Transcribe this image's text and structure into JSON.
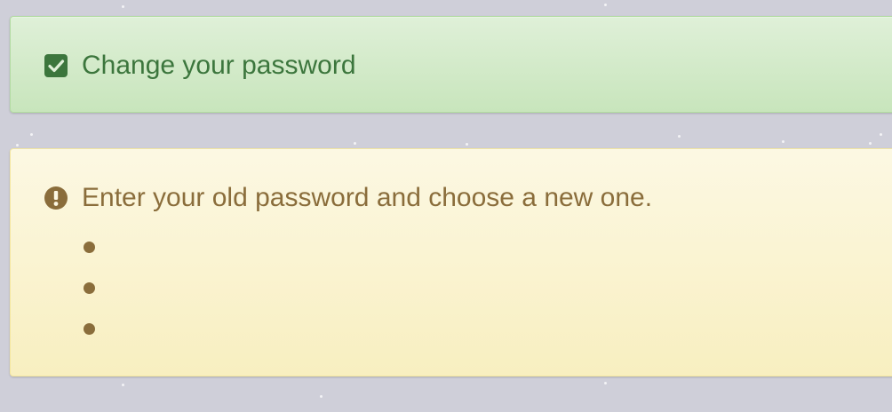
{
  "success_alert": {
    "icon": "check-square-icon",
    "title": "Change your password",
    "color": "#3c763d",
    "background": "#dff0d8"
  },
  "warning_alert": {
    "icon": "exclamation-circle-icon",
    "message": "Enter your old password and choose a new one.",
    "items": [
      "",
      "",
      ""
    ],
    "color": "#8a6d3b",
    "background": "#fcf8e3"
  }
}
